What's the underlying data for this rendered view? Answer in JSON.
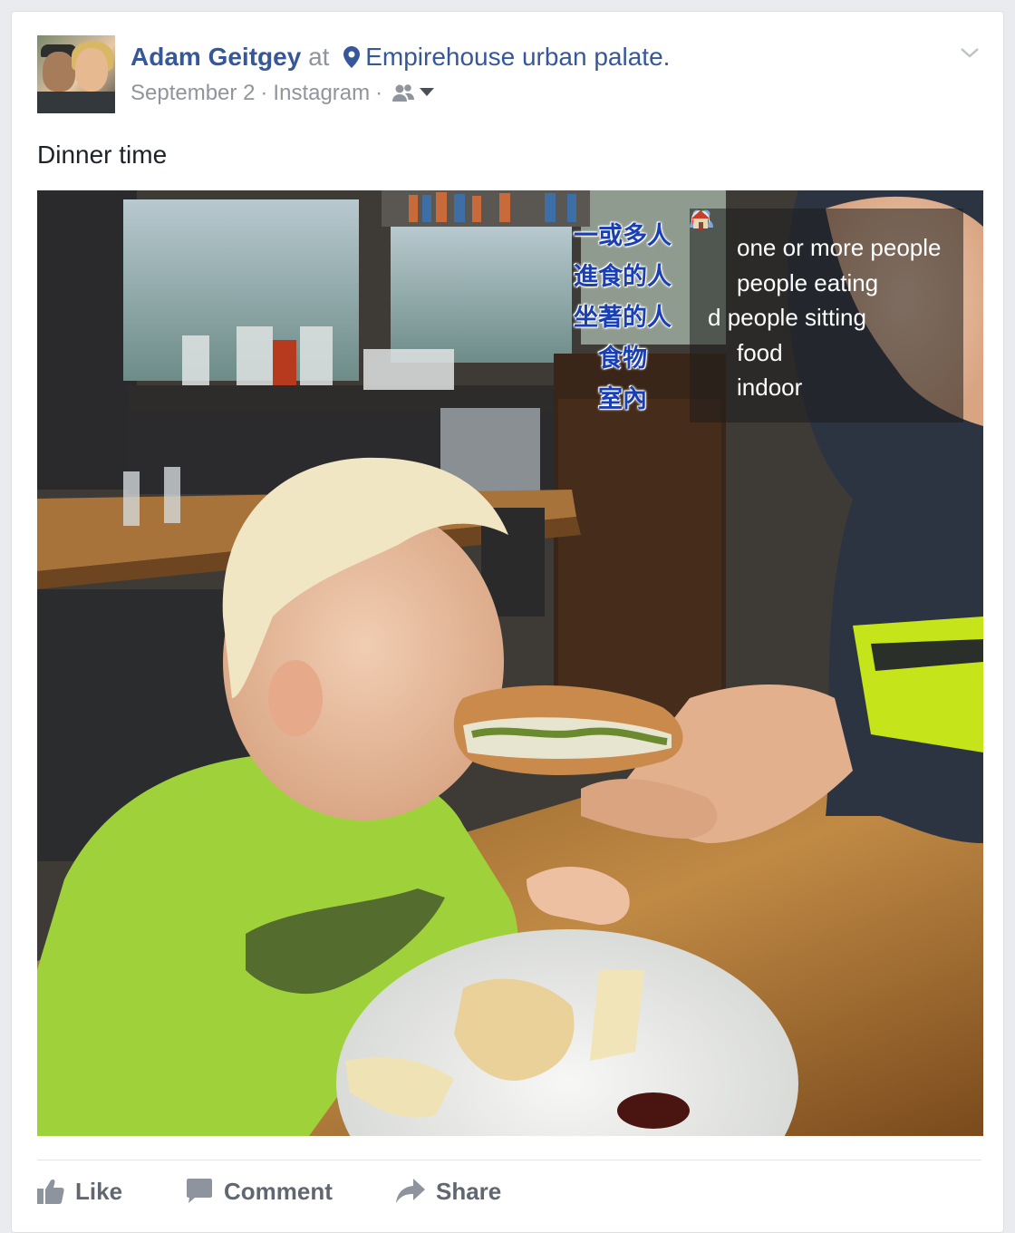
{
  "post": {
    "author": "Adam Geitgey",
    "at_word": "at",
    "place": "Empirehouse urban palate.",
    "date": "September 2",
    "source": "Instagram",
    "separator": "·",
    "privacy_icon": "friends-icon",
    "text": "Dinner time"
  },
  "photo": {
    "tags_zh": [
      "一或多人",
      "進食的人",
      "坐著的人",
      "食物",
      "室內"
    ],
    "tags_en": [
      {
        "icon": "people-icon",
        "label": "one or more people"
      },
      {
        "icon": "plate-icon",
        "label": "people eating"
      },
      {
        "icon": "",
        "label": "people sitting",
        "prefix": "d"
      },
      {
        "icon": "apple-icon",
        "label": "food"
      },
      {
        "icon": "house-icon",
        "label": "indoor"
      }
    ]
  },
  "actions": {
    "like": "Like",
    "comment": "Comment",
    "share": "Share"
  },
  "colors": {
    "link": "#365899",
    "meta": "#90949c",
    "action": "#616770",
    "zh_tag": "#1a3fb3"
  }
}
